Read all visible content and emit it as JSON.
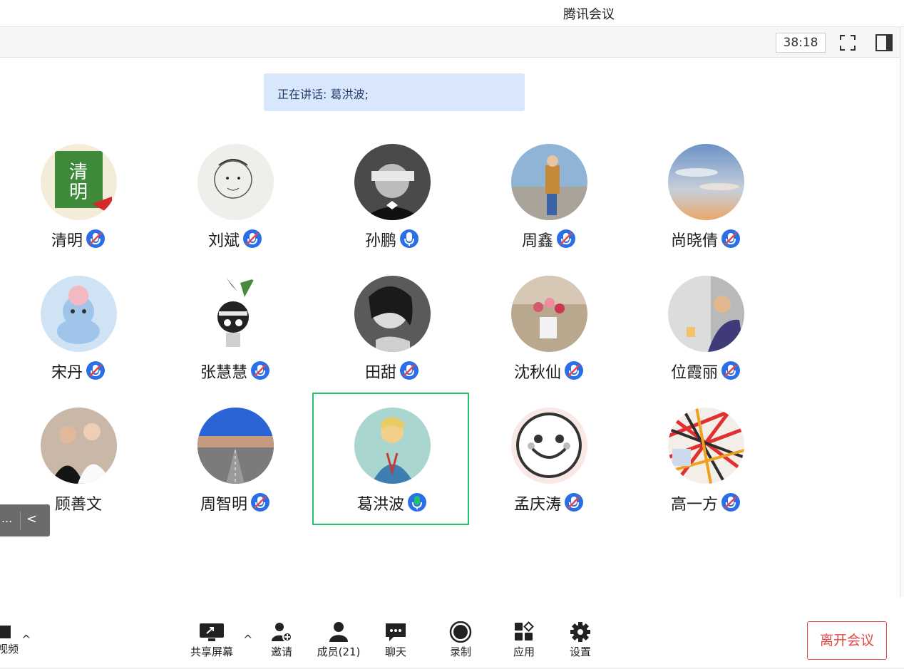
{
  "window": {
    "title": "腾讯会议"
  },
  "topbar": {
    "timer": "38:18"
  },
  "speaking": {
    "text": "正在讲话: 葛洪波;"
  },
  "participants": [
    {
      "name": "清明",
      "mic": "muted"
    },
    {
      "name": "刘斌",
      "mic": "muted"
    },
    {
      "name": "孙鹏",
      "mic": "on"
    },
    {
      "name": "周鑫",
      "mic": "muted"
    },
    {
      "name": "尚晓倩",
      "mic": "muted"
    },
    {
      "name": "宋丹",
      "mic": "muted"
    },
    {
      "name": "张慧慧",
      "mic": "muted"
    },
    {
      "name": "田甜",
      "mic": "muted"
    },
    {
      "name": "沈秋仙",
      "mic": "muted"
    },
    {
      "name": "位霞丽",
      "mic": "muted"
    },
    {
      "name": "顾善文",
      "mic": "none"
    },
    {
      "name": "周智明",
      "mic": "muted"
    },
    {
      "name": "葛洪波",
      "mic": "speaking"
    },
    {
      "name": "孟庆涛",
      "mic": "muted"
    },
    {
      "name": "高一方",
      "mic": "muted"
    }
  ],
  "mini_panel": {
    "dots": "...",
    "collapse": "<"
  },
  "toolbar": {
    "video_label": "视频",
    "share_label": "共享屏幕",
    "invite_label": "邀请",
    "members_label": "成员(21)",
    "chat_label": "聊天",
    "record_label": "录制",
    "apps_label": "应用",
    "settings_label": "设置",
    "leave_label": "离开会议"
  },
  "colors": {
    "accent_blue": "#2a6fe8",
    "speaking_green": "#22c46a",
    "leave_red": "#e64545",
    "banner_bg": "#d8e7fb"
  }
}
